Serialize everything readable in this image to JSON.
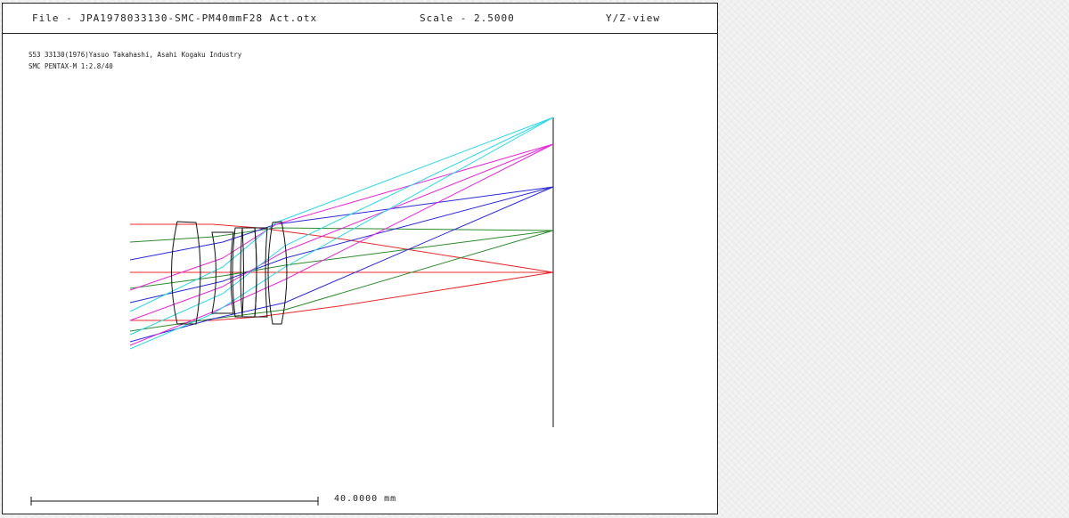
{
  "header": {
    "file": "File - JPA1978033130-SMC-PM40mmF28 Act.otx",
    "scale": "Scale - 2.5000",
    "view": "Y/Z-view"
  },
  "description": {
    "line1": "S53 33130(1976)Yasuo Takahashi, Asahi Kogaku Industry",
    "line2": "SMC PENTAX-M 1:2.8/40"
  },
  "scale_bar": {
    "label": "40.0000 mm"
  },
  "ray_colors": {
    "axis": "#e8282a",
    "field1": "#2e8a2e",
    "field2": "#2a2ad8",
    "field3": "#e82ad8",
    "field4": "#2ad8e8"
  },
  "lens_color": "#111111"
}
